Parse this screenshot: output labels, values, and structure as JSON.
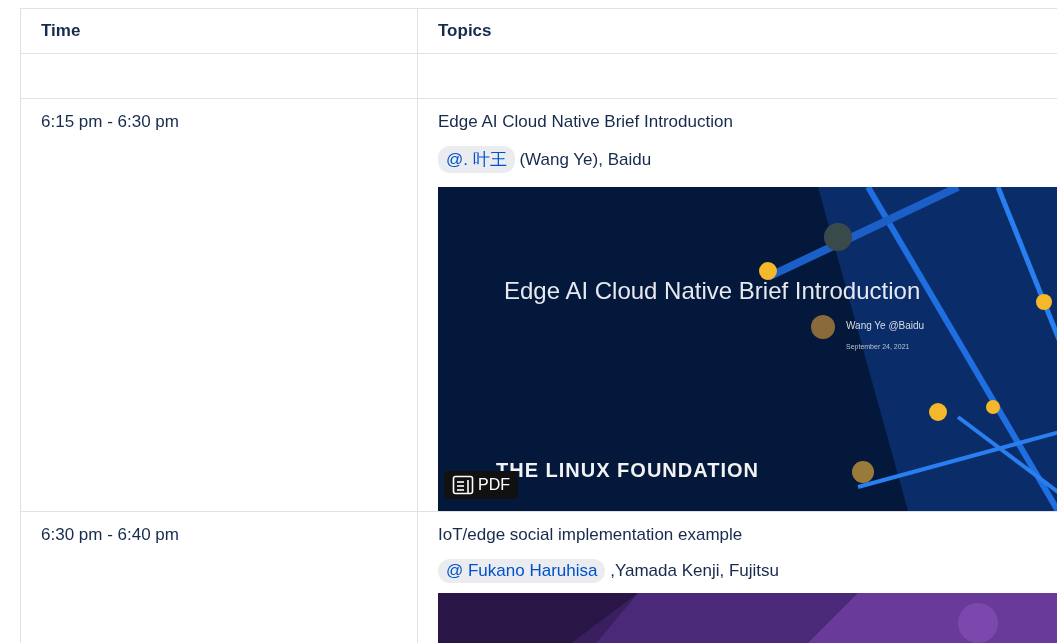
{
  "table": {
    "columns": [
      "Time",
      "Topics"
    ],
    "rows": [
      {
        "kind": "empty"
      },
      {
        "kind": "session",
        "time": "6:15 pm - 6:30 pm",
        "title": "Edge AI Cloud Native Brief Introduction",
        "mention": "@. 叶王",
        "speakers": " (Wang Ye), Baidu",
        "attachment": {
          "kind": "slide",
          "slide_title": "Edge AI Cloud Native Brief Introduction",
          "slide_author": "Wang Ye @Baidu",
          "slide_date": "September 24, 2021",
          "slide_footer": "THE LINUX FOUNDATION",
          "badge": "PDF"
        }
      },
      {
        "kind": "session",
        "time": "6:30 pm - 6:40 pm",
        "title": "IoT/edge social implementation example",
        "mention": "@ Fukano Haruhisa",
        "speakers": " ,Yamada Kenji, Fujitsu"
      }
    ]
  }
}
